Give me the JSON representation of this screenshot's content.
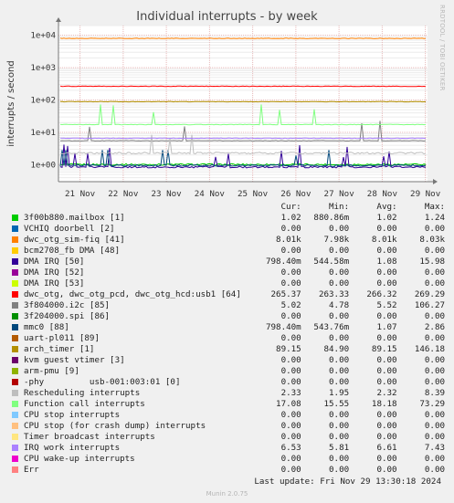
{
  "header": {
    "watermark": "RRDTOOL / TOBI OETIKER"
  },
  "chart_data": {
    "type": "line",
    "title": "Individual interrupts - by week",
    "ylabel": "interrupts / second",
    "yscale": "log",
    "ylim": [
      0.3,
      20000
    ],
    "yticks": [
      1,
      10,
      100,
      1000,
      10000
    ],
    "ytick_labels": [
      "1e+00",
      "1e+01",
      "1e+02",
      "1e+03",
      "1e+04"
    ],
    "x_range": [
      "2024-11-21",
      "2024-11-29 13:30"
    ],
    "xtick_labels": [
      "21 Nov",
      "22 Nov",
      "23 Nov",
      "24 Nov",
      "25 Nov",
      "26 Nov",
      "27 Nov",
      "28 Nov",
      "29 Nov"
    ],
    "grid": true,
    "legend_placement": "below",
    "columns": [
      "Cur:",
      "Min:",
      "Avg:",
      "Max:"
    ],
    "series": [
      {
        "name": "3f00b880.mailbox [1]",
        "color": "#00cc00",
        "cur": "1.02",
        "min": "880.86m",
        "avg": "1.02",
        "max": "1.24",
        "level": 1.02
      },
      {
        "name": "VCHIQ doorbell [2]",
        "color": "#0066b3",
        "cur": "0.00",
        "min": "0.00",
        "avg": "0.00",
        "max": "0.00",
        "level": 0
      },
      {
        "name": "dwc_otg_sim-fiq [41]",
        "color": "#ff8000",
        "cur": "8.01k",
        "min": "7.98k",
        "avg": "8.01k",
        "max": "8.03k",
        "level": 8010
      },
      {
        "name": "bcm2708_fb DMA [48]",
        "color": "#ffcc00",
        "cur": "0.00",
        "min": "0.00",
        "avg": "0.00",
        "max": "0.00",
        "level": 0
      },
      {
        "name": "DMA IRQ [50]",
        "color": "#330099",
        "cur": "798.40m",
        "min": "544.58m",
        "avg": "1.08",
        "max": "15.98",
        "level": 0.85
      },
      {
        "name": "DMA IRQ [52]",
        "color": "#990099",
        "cur": "0.00",
        "min": "0.00",
        "avg": "0.00",
        "max": "0.00",
        "level": 0
      },
      {
        "name": "DMA IRQ [53]",
        "color": "#ccff00",
        "cur": "0.00",
        "min": "0.00",
        "avg": "0.00",
        "max": "0.00",
        "level": 0
      },
      {
        "name": "dwc_otg, dwc_otg_pcd, dwc_otg_hcd:usb1 [64]",
        "color": "#ff0000",
        "cur": "265.37",
        "min": "263.33",
        "avg": "266.32",
        "max": "269.29",
        "level": 266
      },
      {
        "name": "3f804000.i2c [85]",
        "color": "#808080",
        "cur": "5.02",
        "min": "4.78",
        "avg": "5.52",
        "max": "106.27",
        "level": 5.5
      },
      {
        "name": "3f204000.spi [86]",
        "color": "#008f00",
        "cur": "0.00",
        "min": "0.00",
        "avg": "0.00",
        "max": "0.00",
        "level": 0
      },
      {
        "name": "mmc0 [88]",
        "color": "#00487d",
        "cur": "798.40m",
        "min": "543.76m",
        "avg": "1.07",
        "max": "2.86",
        "level": 0.95
      },
      {
        "name": "uart-pl011 [89]",
        "color": "#b35a00",
        "cur": "0.00",
        "min": "0.00",
        "avg": "0.00",
        "max": "0.00",
        "level": 0
      },
      {
        "name": "arch_timer [1]",
        "color": "#b38f00",
        "cur": "89.15",
        "min": "84.90",
        "avg": "89.15",
        "max": "146.18",
        "level": 89.15
      },
      {
        "name": "kvm guest vtimer [3]",
        "color": "#6b006b",
        "cur": "0.00",
        "min": "0.00",
        "avg": "0.00",
        "max": "0.00",
        "level": 0
      },
      {
        "name": "arm-pmu [9]",
        "color": "#8fb300",
        "cur": "0.00",
        "min": "0.00",
        "avg": "0.00",
        "max": "0.00",
        "level": 0
      },
      {
        "name": "-phy         usb-001:003:01 [0]",
        "color": "#b30000",
        "cur": "0.00",
        "min": "0.00",
        "avg": "0.00",
        "max": "0.00",
        "level": 0
      },
      {
        "name": "Rescheduling interrupts",
        "color": "#bebebe",
        "cur": "2.33",
        "min": "1.95",
        "avg": "2.32",
        "max": "8.39",
        "level": 2.3
      },
      {
        "name": "Function call interrupts",
        "color": "#80ff80",
        "cur": "17.08",
        "min": "15.55",
        "avg": "18.18",
        "max": "73.29",
        "level": 17.5
      },
      {
        "name": "CPU stop interrupts",
        "color": "#80c9ff",
        "cur": "0.00",
        "min": "0.00",
        "avg": "0.00",
        "max": "0.00",
        "level": 0
      },
      {
        "name": "CPU stop (for crash dump) interrupts",
        "color": "#ffc080",
        "cur": "0.00",
        "min": "0.00",
        "avg": "0.00",
        "max": "0.00",
        "level": 0
      },
      {
        "name": "Timer broadcast interrupts",
        "color": "#ffe680",
        "cur": "0.00",
        "min": "0.00",
        "avg": "0.00",
        "max": "0.00",
        "level": 0
      },
      {
        "name": "IRQ work interrupts",
        "color": "#aa80ff",
        "cur": "6.53",
        "min": "5.81",
        "avg": "6.61",
        "max": "7.43",
        "level": 6.6
      },
      {
        "name": "CPU wake-up interrupts",
        "color": "#ee00cc",
        "cur": "0.00",
        "min": "0.00",
        "avg": "0.00",
        "max": "0.00",
        "level": 0
      },
      {
        "name": "Err",
        "color": "#ff8080",
        "cur": "0.00",
        "min": "0.00",
        "avg": "0.00",
        "max": "0.00",
        "level": 0
      }
    ]
  },
  "footer": {
    "last_update": "Last update: Fri Nov 29 13:30:18 2024",
    "version": "Munin 2.0.75"
  }
}
